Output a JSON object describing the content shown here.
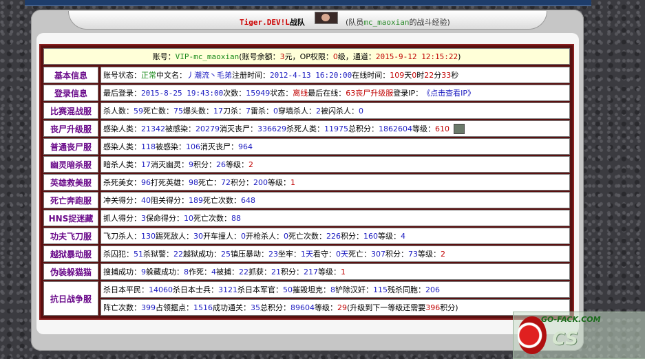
{
  "header": {
    "team_name": "Tiger.DEV!L",
    "team_suffix": "战队",
    "member_prefix": "(队员",
    "member_name": "mc_maoxian",
    "member_suffix": "的战斗经验)"
  },
  "account": {
    "label_account": "账号：",
    "account_id": "VIP-mc_maoxian",
    "label_balance": "(账号余额：",
    "balance": "3",
    "balance_unit": "元，OP权限：",
    "op_level": "0",
    "op_unit": "级，通道：",
    "channel_time": "2015-9-12 12:15:22",
    "close_paren": ")"
  },
  "rows": {
    "basic": {
      "label": "基本信息",
      "status_label": "账号状态：",
      "status": "正常",
      "cn_label": " 中文名：",
      "cn_name": "丿潮流丶毛弟",
      "reg_label": " 注册时间：",
      "reg_time": "2012-4-13 16:20:00",
      "online_label": " 在线时间：",
      "days": "109",
      "days_unit": "天",
      "hours": "0",
      "hours_unit": "时",
      "minutes": "22",
      "minutes_unit": "分",
      "seconds": "33",
      "seconds_unit": "秒"
    },
    "login": {
      "label": "登录信息",
      "last_label": "最后登录：",
      "last_time": "2015-8-25 19:43:00",
      "count_label": " 次数：",
      "count": "15949",
      "state_label": " 状态：",
      "state": "离线",
      "last_online_label": " 最后在线：",
      "last_online": "63丧尸升级服",
      "ip_label": " 登录IP：",
      "ip_link": "《点击查看IP》"
    },
    "match": {
      "label": "比赛混战服",
      "items": [
        {
          "k": "杀人数：",
          "v": "59"
        },
        {
          "k": " 死亡数：",
          "v": "75"
        },
        {
          "k": " 爆头数：",
          "v": "17"
        },
        {
          "k": " 刀杀：",
          "v": "7"
        },
        {
          "k": " 雷杀：",
          "v": "0"
        },
        {
          "k": " 穿墙杀人：",
          "v": "2"
        },
        {
          "k": " 被闪杀人：",
          "v": "0"
        }
      ]
    },
    "zombie_up": {
      "label": "丧尸升级服",
      "items": [
        {
          "k": "感染人类：",
          "v": "21342"
        },
        {
          "k": " 被感染：",
          "v": "20279"
        },
        {
          "k": " 消灭丧尸：",
          "v": "336629"
        },
        {
          "k": " 杀死人类：",
          "v": "11975"
        },
        {
          "k": " 总积分：",
          "v": "1862604"
        }
      ],
      "level_label": " 等级：",
      "level": "610"
    },
    "zombie_normal": {
      "label": "普通丧尸服",
      "items": [
        {
          "k": "感染人类：",
          "v": "118"
        },
        {
          "k": " 被感染：",
          "v": "106"
        },
        {
          "k": " 消灭丧尸：",
          "v": "964"
        }
      ]
    },
    "ghost": {
      "label": "幽灵暗杀服",
      "items": [
        {
          "k": "暗杀人类：",
          "v": "17"
        },
        {
          "k": " 消灭幽灵：",
          "v": "9"
        },
        {
          "k": " 积分：",
          "v": "26"
        }
      ],
      "level_label": " 等级：",
      "level": "2"
    },
    "hero": {
      "label": "英雄救美服",
      "items": [
        {
          "k": "杀死美女：",
          "v": "96"
        },
        {
          "k": " 打死英雄：",
          "v": "98"
        },
        {
          "k": " 死亡：",
          "v": "72"
        },
        {
          "k": " 积分：",
          "v": "200"
        }
      ],
      "level_label": " 等级：",
      "level": "1"
    },
    "deathrun": {
      "label": "死亡奔跑服",
      "items": [
        {
          "k": "冲关得分：",
          "v": "40"
        },
        {
          "k": " 阻关得分：",
          "v": "189"
        },
        {
          "k": " 死亡次数：",
          "v": "648"
        }
      ]
    },
    "hns": {
      "label": "HNS捉迷藏",
      "items": [
        {
          "k": "抓人得分：",
          "v": "3"
        },
        {
          "k": " 保命得分：",
          "v": "10"
        },
        {
          "k": " 死亡次数：",
          "v": "88"
        }
      ]
    },
    "kungfu": {
      "label": "功夫飞刀服",
      "items": [
        {
          "k": "飞刀杀人：",
          "v": "130"
        },
        {
          "k": " 踢死敌人：",
          "v": "30"
        },
        {
          "k": " 开车撞人：",
          "v": "0"
        },
        {
          "k": " 开枪杀人：",
          "v": "0"
        },
        {
          "k": " 死亡次数：",
          "v": "226"
        },
        {
          "k": " 积分：",
          "v": "160"
        },
        {
          "k": " 等级：",
          "v": "4"
        }
      ]
    },
    "jail": {
      "label": "越狱暴动服",
      "items": [
        {
          "k": "杀囚犯：",
          "v": "51"
        },
        {
          "k": " 杀狱警：",
          "v": "22"
        },
        {
          "k": " 越狱成功：",
          "v": "25"
        },
        {
          "k": " 镇压暴动：",
          "v": "23"
        },
        {
          "k": " 坐牢：",
          "v": "1天"
        },
        {
          "k": " 看守：",
          "v": "0天"
        },
        {
          "k": " 死亡：",
          "v": "307"
        },
        {
          "k": " 积分：",
          "v": "73"
        }
      ],
      "level_label": " 等级：",
      "level": "2"
    },
    "disguise": {
      "label": "伪装躲猫猫",
      "items": [
        {
          "k": "搜捕成功：",
          "v": "9"
        },
        {
          "k": " 躲藏成功：",
          "v": "8"
        },
        {
          "k": " 作死：",
          "v": "4"
        },
        {
          "k": " 被捕：",
          "v": "22"
        },
        {
          "k": " 抓获：",
          "v": "21"
        },
        {
          "k": " 积分：",
          "v": "217"
        }
      ],
      "level_label": " 等级：",
      "level": "1"
    },
    "war": {
      "label": "抗日战争服",
      "line1": [
        {
          "k": "杀日本平民：",
          "v": "14060"
        },
        {
          "k": " 杀日本士兵：",
          "v": "3121"
        },
        {
          "k": " 杀日本军官：",
          "v": "50"
        },
        {
          "k": " 摧毁坦克：",
          "v": "8"
        },
        {
          "k": " 铲除汉奸：",
          "v": "115"
        },
        {
          "k": " 残杀同胞：",
          "v": "206"
        }
      ],
      "line2": [
        {
          "k": "阵亡次数：",
          "v": "399"
        },
        {
          "k": " 占领据点：",
          "v": "1516"
        },
        {
          "k": " 成功通关：",
          "v": "35"
        },
        {
          "k": " 总积分：",
          "v": "89604"
        }
      ],
      "level_label": " 等级：",
      "level": "29",
      "next_prefix": " (升级到下一等级还需要",
      "next_value": "396",
      "next_suffix": "积分)"
    }
  },
  "watermark": {
    "site": "GO-FACK.COM"
  },
  "colors": {
    "frame": "#5a1010",
    "category_text": "#6a0a8a",
    "number_blue": "#1a1ac0",
    "accent_red": "#c00000",
    "status_green": "#1a8a1a"
  }
}
